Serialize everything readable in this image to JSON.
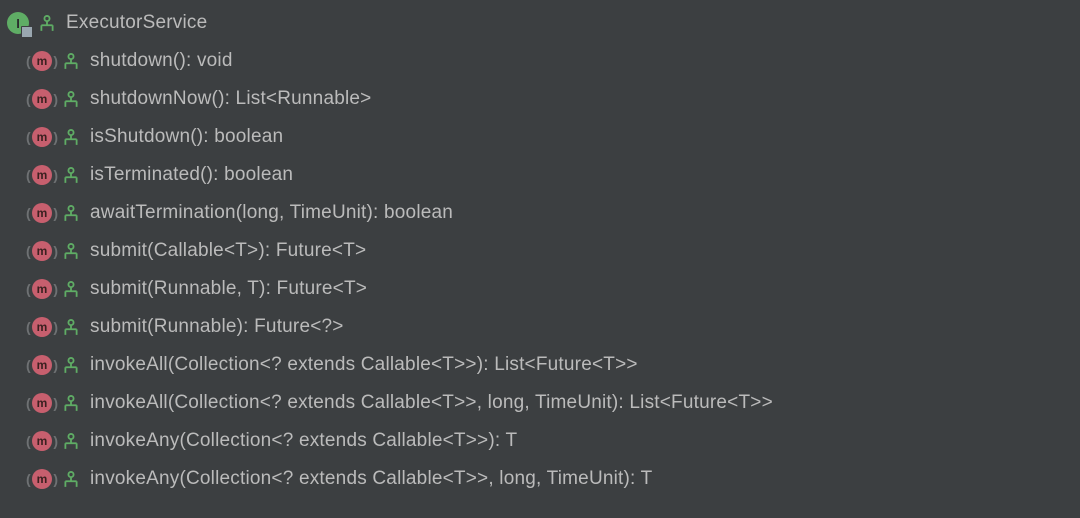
{
  "interface": {
    "name": "ExecutorService",
    "iconLetter": "I"
  },
  "methods": [
    {
      "signature": "shutdown(): void",
      "iconLetter": "m"
    },
    {
      "signature": "shutdownNow(): List<Runnable>",
      "iconLetter": "m"
    },
    {
      "signature": "isShutdown(): boolean",
      "iconLetter": "m"
    },
    {
      "signature": "isTerminated(): boolean",
      "iconLetter": "m"
    },
    {
      "signature": "awaitTermination(long, TimeUnit): boolean",
      "iconLetter": "m"
    },
    {
      "signature": "submit(Callable<T>): Future<T>",
      "iconLetter": "m"
    },
    {
      "signature": "submit(Runnable, T): Future<T>",
      "iconLetter": "m"
    },
    {
      "signature": "submit(Runnable): Future<?>",
      "iconLetter": "m"
    },
    {
      "signature": "invokeAll(Collection<? extends Callable<T>>): List<Future<T>>",
      "iconLetter": "m"
    },
    {
      "signature": "invokeAll(Collection<? extends Callable<T>>, long, TimeUnit): List<Future<T>>",
      "iconLetter": "m"
    },
    {
      "signature": "invokeAny(Collection<? extends Callable<T>>): T",
      "iconLetter": "m"
    },
    {
      "signature": "invokeAny(Collection<? extends Callable<T>>, long, TimeUnit): T",
      "iconLetter": "m"
    }
  ],
  "colors": {
    "background": "#3c3f41",
    "text": "#bbbbbb",
    "interfaceIcon": "#5fad65",
    "methodIcon": "#c75f6e",
    "abstractIcon": "#5fad65"
  }
}
